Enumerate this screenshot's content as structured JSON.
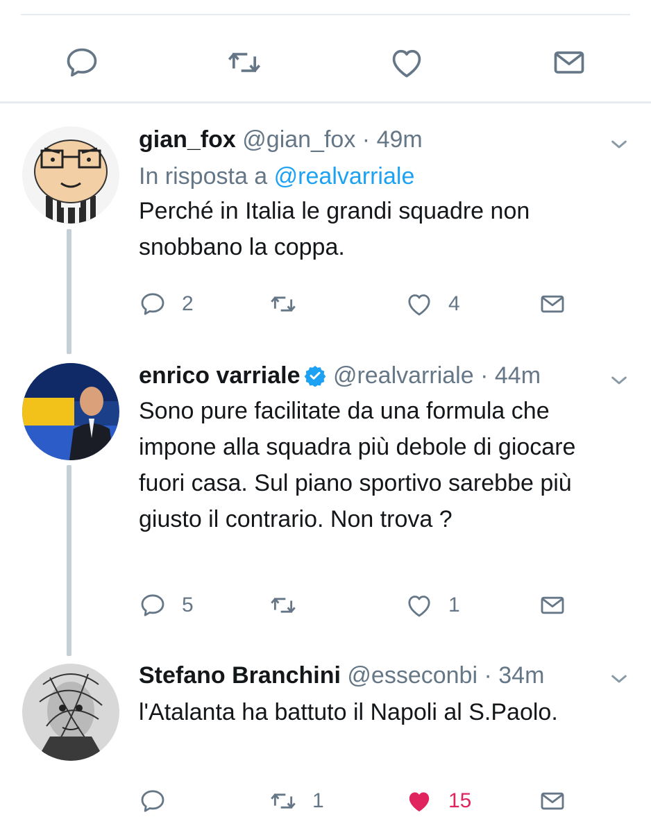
{
  "colors": {
    "accent": "#1da1f2",
    "like": "#e0245e",
    "muted": "#657786",
    "text": "#14171a",
    "line": "#c4cfd6"
  },
  "top_actions": {
    "icons": [
      "reply-icon",
      "retweet-icon",
      "like-icon",
      "direct-message-icon"
    ]
  },
  "tweets": [
    {
      "name": "gian_fox",
      "handle": "@gian_fox",
      "dot": "·",
      "time": "49m",
      "reply_prefix": "In risposta a",
      "reply_handle": "@realvarriale",
      "text": "Perché in Italia le grandi squadre non snobbano la coppa.",
      "replies": "2",
      "retweets": "",
      "likes": "4",
      "verified": false,
      "liked": false
    },
    {
      "name": "enrico varriale",
      "handle": "@realvarriale",
      "dot": "·",
      "time": "44m",
      "text": "Sono pure facilitate da una formula che impone alla squadra più debole di giocare fuori casa. Sul piano sportivo sarebbe più giusto il contrario. Non trova ?",
      "replies": "5",
      "retweets": "",
      "likes": "1",
      "verified": true,
      "liked": false
    },
    {
      "name": "Stefano Branchini",
      "handle": "@esseconbi",
      "dot": "·",
      "time": "34m",
      "text": "l'Atalanta ha battuto il Napoli al S.Paolo.",
      "replies": "",
      "retweets": "1",
      "likes": "15",
      "verified": false,
      "liked": true
    }
  ]
}
